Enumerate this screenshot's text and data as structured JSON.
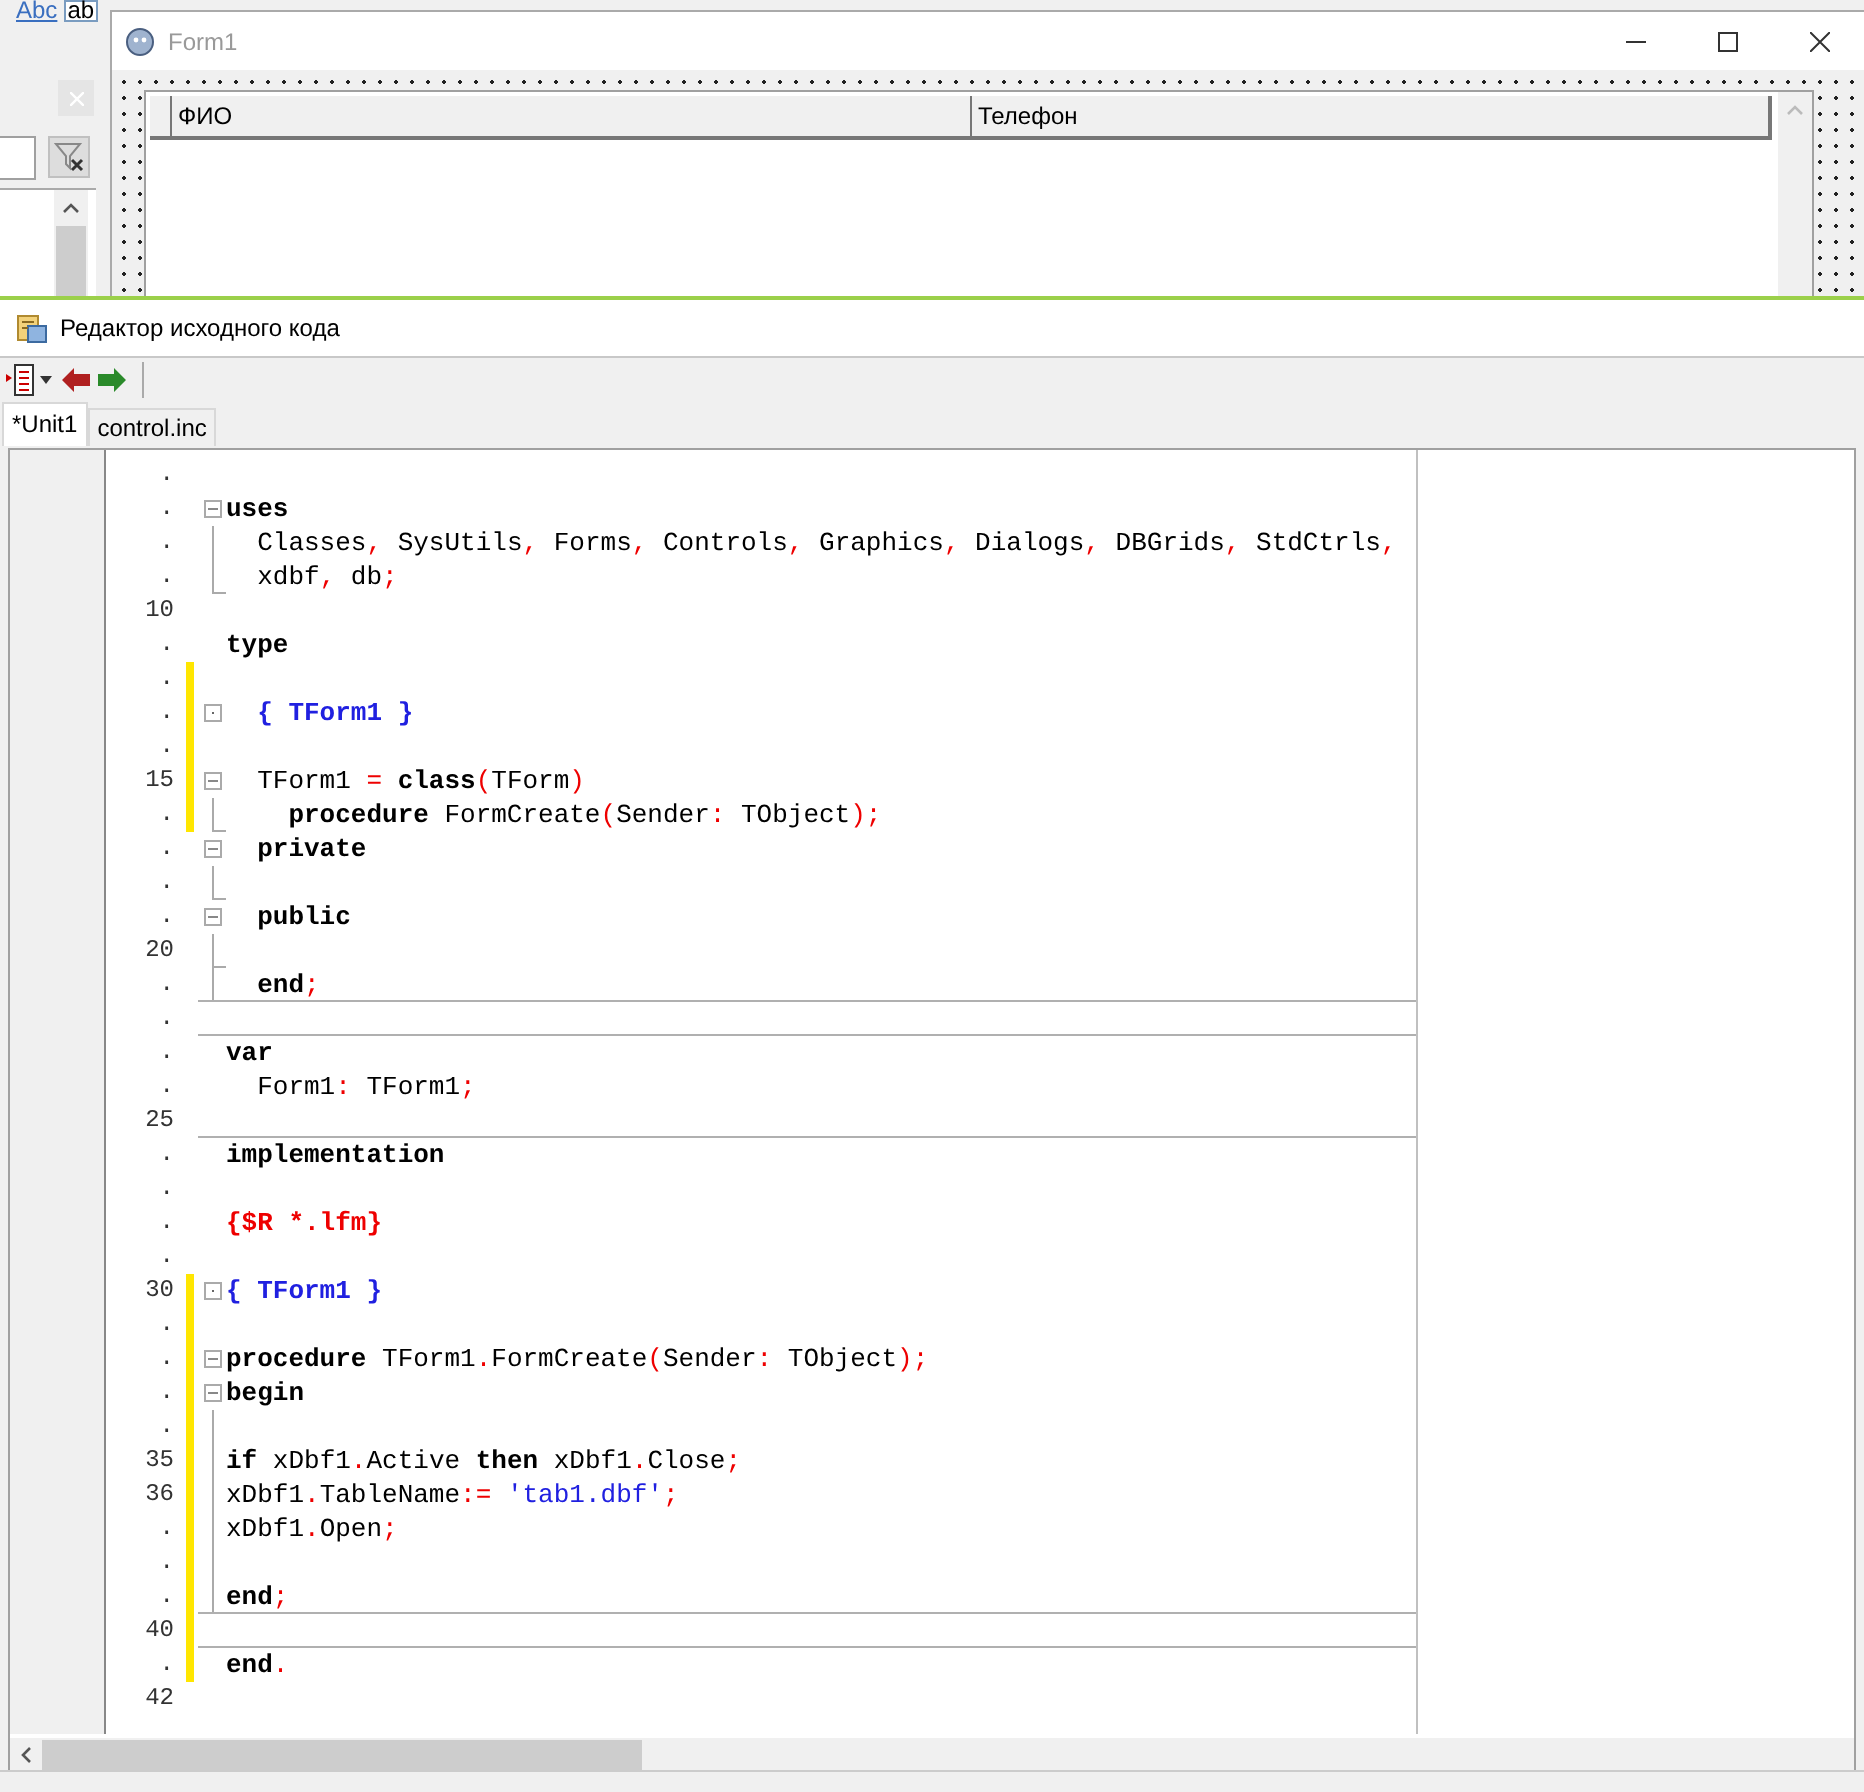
{
  "ide_palette": {
    "labels": [
      "Abc",
      "ab"
    ]
  },
  "form_window": {
    "title": "Form1",
    "grid": {
      "columns": [
        {
          "label": "ФИО"
        },
        {
          "label": "Телефон"
        }
      ]
    }
  },
  "editor": {
    "title": "Редактор исходного кода",
    "tabs": [
      {
        "label": "*Unit1",
        "selected": true
      },
      {
        "label": "control.inc",
        "selected": false
      }
    ],
    "lines": [
      {
        "number": ".",
        "modified": false,
        "divider_above": false
      },
      {
        "number": ".",
        "modified": false,
        "divider_above": false,
        "fold": {
          "kind": "open"
        },
        "tokens": [
          {
            "text": "uses",
            "kind": "keyword"
          }
        ]
      },
      {
        "number": ".",
        "modified": false,
        "divider_above": false,
        "fold": {
          "kind": "line"
        },
        "tokens": [
          {
            "text": "  Classes",
            "kind": "identifier"
          },
          {
            "text": ",",
            "kind": "symbol"
          },
          {
            "text": " SysUtils",
            "kind": "identifier"
          },
          {
            "text": ",",
            "kind": "symbol"
          },
          {
            "text": " Forms",
            "kind": "identifier"
          },
          {
            "text": ",",
            "kind": "symbol"
          },
          {
            "text": " Controls",
            "kind": "identifier"
          },
          {
            "text": ",",
            "kind": "symbol"
          },
          {
            "text": " Graphics",
            "kind": "identifier"
          },
          {
            "text": ",",
            "kind": "symbol"
          },
          {
            "text": " Dialogs",
            "kind": "identifier"
          },
          {
            "text": ",",
            "kind": "symbol"
          },
          {
            "text": " DBGrids",
            "kind": "identifier"
          },
          {
            "text": ",",
            "kind": "symbol"
          },
          {
            "text": " StdCtrls",
            "kind": "identifier"
          },
          {
            "text": ",",
            "kind": "symbol"
          }
        ]
      },
      {
        "number": ".",
        "modified": false,
        "divider_above": false,
        "fold": {
          "kind": "end"
        },
        "tokens": [
          {
            "text": "  xdbf",
            "kind": "identifier"
          },
          {
            "text": ",",
            "kind": "symbol"
          },
          {
            "text": " db",
            "kind": "identifier"
          },
          {
            "text": ";",
            "kind": "symbol"
          }
        ]
      },
      {
        "number": "10",
        "modified": false,
        "divider_above": false
      },
      {
        "number": ".",
        "modified": false,
        "divider_above": false,
        "tokens": [
          {
            "text": "type",
            "kind": "keyword"
          }
        ]
      },
      {
        "number": ".",
        "modified": true,
        "divider_above": false
      },
      {
        "number": ".",
        "modified": true,
        "divider_above": false,
        "fold": {
          "kind": "dot"
        },
        "tokens": [
          {
            "text": "  { TForm1 }",
            "kind": "comment"
          }
        ]
      },
      {
        "number": ".",
        "modified": true,
        "divider_above": false
      },
      {
        "number": "15",
        "modified": true,
        "divider_above": false,
        "fold": {
          "kind": "open"
        },
        "tokens": [
          {
            "text": "  TForm1 ",
            "kind": "identifier"
          },
          {
            "text": "=",
            "kind": "symbol"
          },
          {
            "text": " class",
            "kind": "keyword"
          },
          {
            "text": "(",
            "kind": "symbol"
          },
          {
            "text": "TForm",
            "kind": "identifier"
          },
          {
            "text": ")",
            "kind": "symbol"
          }
        ]
      },
      {
        "number": ".",
        "modified": true,
        "divider_above": false,
        "fold": {
          "kind": "end"
        },
        "tokens": [
          {
            "text": "    procedure",
            "kind": "keyword"
          },
          {
            "text": " FormCreate",
            "kind": "identifier"
          },
          {
            "text": "(",
            "kind": "symbol"
          },
          {
            "text": "Sender",
            "kind": "identifier"
          },
          {
            "text": ":",
            "kind": "symbol"
          },
          {
            "text": " TObject",
            "kind": "identifier"
          },
          {
            "text": ");",
            "kind": "symbol"
          }
        ]
      },
      {
        "number": ".",
        "modified": false,
        "divider_above": false,
        "fold": {
          "kind": "open"
        },
        "tokens": [
          {
            "text": "  private",
            "kind": "keyword"
          }
        ]
      },
      {
        "number": ".",
        "modified": false,
        "divider_above": false,
        "fold": {
          "kind": "end"
        }
      },
      {
        "number": ".",
        "modified": false,
        "divider_above": false,
        "fold": {
          "kind": "open"
        },
        "tokens": [
          {
            "text": "  public",
            "kind": "keyword"
          }
        ]
      },
      {
        "number": "20",
        "modified": false,
        "divider_above": false,
        "fold": {
          "kind": "end"
        }
      },
      {
        "number": ".",
        "modified": false,
        "divider_above": false,
        "fold": {
          "kind": "line"
        },
        "tokens": [
          {
            "text": "  end",
            "kind": "keyword"
          },
          {
            "text": ";",
            "kind": "symbol"
          }
        ]
      },
      {
        "number": ".",
        "modified": false,
        "divider_above": true
      },
      {
        "number": ".",
        "modified": false,
        "divider_above": true,
        "tokens": [
          {
            "text": "var",
            "kind": "keyword"
          }
        ]
      },
      {
        "number": ".",
        "modified": false,
        "divider_above": false,
        "tokens": [
          {
            "text": "  Form1",
            "kind": "identifier"
          },
          {
            "text": ":",
            "kind": "symbol"
          },
          {
            "text": " TForm1",
            "kind": "identifier"
          },
          {
            "text": ";",
            "kind": "symbol"
          }
        ]
      },
      {
        "number": "25",
        "modified": false,
        "divider_above": false
      },
      {
        "number": ".",
        "modified": false,
        "divider_above": true,
        "tokens": [
          {
            "text": "implementation",
            "kind": "keyword"
          }
        ]
      },
      {
        "number": ".",
        "modified": false,
        "divider_above": false
      },
      {
        "number": ".",
        "modified": false,
        "divider_above": false,
        "tokens": [
          {
            "text": "{$R *.lfm}",
            "kind": "directive"
          }
        ]
      },
      {
        "number": ".",
        "modified": false,
        "divider_above": false
      },
      {
        "number": "30",
        "modified": true,
        "divider_above": false,
        "fold": {
          "kind": "dot"
        },
        "tokens": [
          {
            "text": "{ TForm1 }",
            "kind": "comment"
          }
        ]
      },
      {
        "number": ".",
        "modified": true,
        "divider_above": false
      },
      {
        "number": ".",
        "modified": true,
        "divider_above": false,
        "fold": {
          "kind": "open"
        },
        "tokens": [
          {
            "text": "procedure",
            "kind": "keyword"
          },
          {
            "text": " TForm1",
            "kind": "identifier"
          },
          {
            "text": ".",
            "kind": "symbol"
          },
          {
            "text": "FormCreate",
            "kind": "identifier"
          },
          {
            "text": "(",
            "kind": "symbol"
          },
          {
            "text": "Sender",
            "kind": "identifier"
          },
          {
            "text": ":",
            "kind": "symbol"
          },
          {
            "text": " TObject",
            "kind": "identifier"
          },
          {
            "text": ");",
            "kind": "symbol"
          }
        ]
      },
      {
        "number": ".",
        "modified": true,
        "divider_above": false,
        "fold": {
          "kind": "open"
        },
        "tokens": [
          {
            "text": "begin",
            "kind": "keyword"
          }
        ]
      },
      {
        "number": ".",
        "modified": true,
        "divider_above": false,
        "fold": {
          "kind": "line"
        }
      },
      {
        "number": "35",
        "modified": true,
        "divider_above": false,
        "fold": {
          "kind": "line"
        },
        "tokens": [
          {
            "text": "if",
            "kind": "keyword"
          },
          {
            "text": " xDbf1",
            "kind": "identifier"
          },
          {
            "text": ".",
            "kind": "symbol"
          },
          {
            "text": "Active ",
            "kind": "identifier"
          },
          {
            "text": "then",
            "kind": "keyword"
          },
          {
            "text": " xDbf1",
            "kind": "identifier"
          },
          {
            "text": ".",
            "kind": "symbol"
          },
          {
            "text": "Close",
            "kind": "identifier"
          },
          {
            "text": ";",
            "kind": "symbol"
          }
        ]
      },
      {
        "number": "36",
        "modified": true,
        "divider_above": false,
        "fold": {
          "kind": "line"
        },
        "tokens": [
          {
            "text": "xDbf1",
            "kind": "identifier"
          },
          {
            "text": ".",
            "kind": "symbol"
          },
          {
            "text": "TableName",
            "kind": "identifier"
          },
          {
            "text": ":=",
            "kind": "symbol"
          },
          {
            "text": " 'tab1.dbf'",
            "kind": "string"
          },
          {
            "text": ";",
            "kind": "symbol"
          }
        ]
      },
      {
        "number": ".",
        "modified": true,
        "divider_above": false,
        "fold": {
          "kind": "line"
        },
        "tokens": [
          {
            "text": "xDbf1",
            "kind": "identifier"
          },
          {
            "text": ".",
            "kind": "symbol"
          },
          {
            "text": "Open",
            "kind": "identifier"
          },
          {
            "text": ";",
            "kind": "symbol"
          }
        ]
      },
      {
        "number": ".",
        "modified": true,
        "divider_above": false,
        "fold": {
          "kind": "line"
        }
      },
      {
        "number": ".",
        "modified": true,
        "divider_above": false,
        "fold": {
          "kind": "end"
        },
        "tokens": [
          {
            "text": "end",
            "kind": "keyword"
          },
          {
            "text": ";",
            "kind": "symbol"
          }
        ]
      },
      {
        "number": "40",
        "modified": true,
        "divider_above": true
      },
      {
        "number": ".",
        "modified": true,
        "divider_above": true,
        "tokens": [
          {
            "text": "end",
            "kind": "keyword"
          },
          {
            "text": ".",
            "kind": "symbol"
          }
        ]
      },
      {
        "number": "42",
        "modified": false,
        "divider_above": false
      }
    ]
  }
}
